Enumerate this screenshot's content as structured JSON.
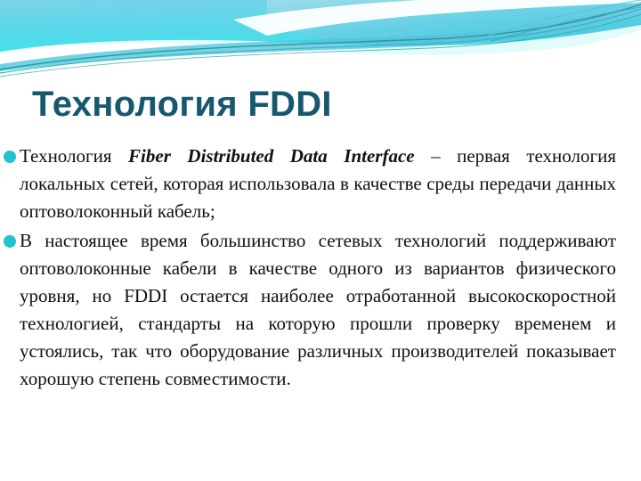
{
  "slide": {
    "title": "Технология FDDI",
    "title_color": "#18586e",
    "background_color": "#ffffff",
    "bullet_color": "#23c1d2",
    "decoration": {
      "name": "wave-ribbon-banner",
      "colors": {
        "cyan_light": "#6fd8ea",
        "cyan_bright": "#46e2e8",
        "blue_mid": "#64c8e4",
        "teal_line": "#1f9e96",
        "teal_ribbon": "#35b5c6",
        "white": "#ffffff"
      }
    },
    "bullets": [
      {
        "lead": "Технология ",
        "emphasis": "Fiber Distributed Data Interface",
        "rest": " – первая технология локальных сетей, которая использовала в качестве среды передачи данных оптоволоконный кабель;"
      },
      {
        "lead": "В настоящее время большинство сетевых технологий поддерживают оптоволоконные кабели в качестве одного из вариантов физического уровня, но FDDI остается наиболее отработанной высокоскоростной технологией, стандарты на которую прошли проверку временем и устоялись, так что оборудование различных производителей показывает хорошую степень совместимости.",
        "emphasis": "",
        "rest": ""
      }
    ]
  }
}
